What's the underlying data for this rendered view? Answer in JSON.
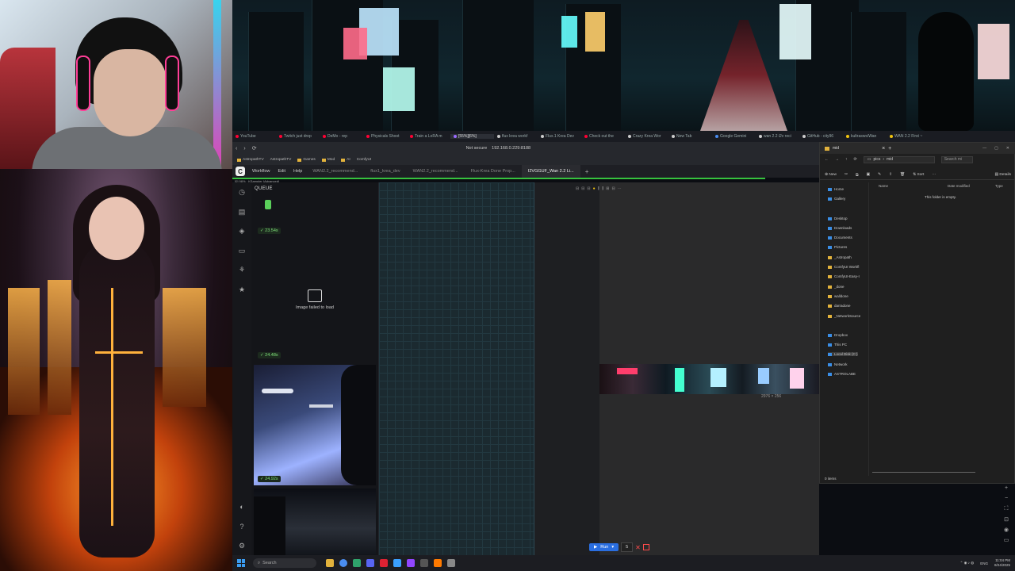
{
  "browser": {
    "tabs": [
      {
        "label": "YouTube",
        "color": "#ff0033",
        "active": false
      },
      {
        "label": "Twitch just drop",
        "color": "#ff0033",
        "active": false
      },
      {
        "label": "DeMo - rep",
        "color": "#ff0033",
        "active": false
      },
      {
        "label": "Physicals Shoot",
        "color": "#ff0033",
        "active": false
      },
      {
        "label": "Train a LoRA m",
        "color": "#ff0033",
        "active": false
      },
      {
        "label": "[55%][6%]",
        "color": "#9b6bff",
        "active": true
      },
      {
        "label": "flux krea workf",
        "color": "#cccccc",
        "active": false
      },
      {
        "label": "Flux.1 Krea Dev",
        "color": "#cccccc",
        "active": false
      },
      {
        "label": "Check out the",
        "color": "#ff0033",
        "active": false
      },
      {
        "label": "Crazy Krea Wor",
        "color": "#cccccc",
        "active": false
      },
      {
        "label": "New Tab",
        "color": "#cccccc",
        "active": false
      },
      {
        "label": "Google Gemini",
        "color": "#4a8df0",
        "active": false
      },
      {
        "label": "wan 2.2 i2v reci",
        "color": "#cccccc",
        "active": false
      },
      {
        "label": "GitHub - city96",
        "color": "#cccccc",
        "active": false
      },
      {
        "label": "kultrasws/Wan",
        "color": "#f2c40f",
        "active": false
      },
      {
        "label": "WAN 2.2 First ~",
        "color": "#f2c40f",
        "active": false
      }
    ],
    "not_secure": "Not secure",
    "url": "192.168.0.229:8188",
    "bookmarks": [
      {
        "label": "AstropathTV",
        "type": "folder"
      },
      {
        "label": "AstropathTV",
        "type": "link"
      },
      {
        "label": "Games",
        "type": "folder"
      },
      {
        "label": "Mod",
        "type": "folder"
      },
      {
        "label": "AI",
        "type": "folder"
      },
      {
        "label": "ComfyUI",
        "type": "link"
      }
    ]
  },
  "comfy": {
    "logo": "C",
    "menus": [
      "Workflow",
      "Edit",
      "Help"
    ],
    "workflow_tabs": [
      {
        "label": "WAN2.2_recommend...",
        "active": false
      },
      {
        "label": "flux1_krea_dev",
        "active": false
      },
      {
        "label": "WAN2.2_recommend...",
        "active": false
      },
      {
        "label": "Flux-Krea Done Prop...",
        "active": false
      },
      {
        "label": "I2VGGUF_Wan 2.2 Li...",
        "active": true
      }
    ],
    "progress_caption": "[0] 98% · KSampler (Advanced)",
    "progress_percent": 98,
    "queue_title": "QUEUE",
    "queue_badges": [
      "23.54s",
      "24.48s",
      "24.92s"
    ],
    "failed_text": "Image failed to load",
    "strip_caption": "2976 × 256",
    "run_label": "Run",
    "run_count": "5"
  },
  "explorer": {
    "title": "mid",
    "new_label": "New",
    "path": [
      "pics",
      "mid"
    ],
    "search_placeholder": "Search mi",
    "sort_label": "Sort",
    "details_label": "Details",
    "tree": [
      {
        "label": "Home",
        "icon": "home"
      },
      {
        "label": "Gallery",
        "icon": "gallery"
      },
      {
        "label": "Desktop",
        "icon": "folder"
      },
      {
        "label": "Downloads",
        "icon": "folder"
      },
      {
        "label": "Documents",
        "icon": "folder"
      },
      {
        "label": "Pictures",
        "icon": "folder"
      },
      {
        "label": "_Astropath",
        "icon": "folder"
      },
      {
        "label": "ComfyUI Workfl",
        "icon": "folder"
      },
      {
        "label": "ComfyUI-Easy-I",
        "icon": "folder"
      },
      {
        "label": "_done",
        "icon": "folder"
      },
      {
        "label": "walldone",
        "icon": "folder"
      },
      {
        "label": "darradone",
        "icon": "folder"
      },
      {
        "label": "_NetworkSource",
        "icon": "folder"
      },
      {
        "label": "Dropbox",
        "icon": "cloud"
      },
      {
        "label": "This PC",
        "icon": "pc"
      },
      {
        "label": "Local Disk (C:)",
        "icon": "drive"
      },
      {
        "label": "Network",
        "icon": "network"
      },
      {
        "label": "ASTROLABE",
        "icon": "pc"
      }
    ],
    "columns": [
      "Name",
      "Date modified",
      "Type"
    ],
    "empty_text": "This folder is empty.",
    "status": "0 items"
  },
  "taskbar": {
    "search_placeholder": "Search",
    "lang": "ENG",
    "time": "11:04 PM",
    "date": "8/24/2025"
  }
}
